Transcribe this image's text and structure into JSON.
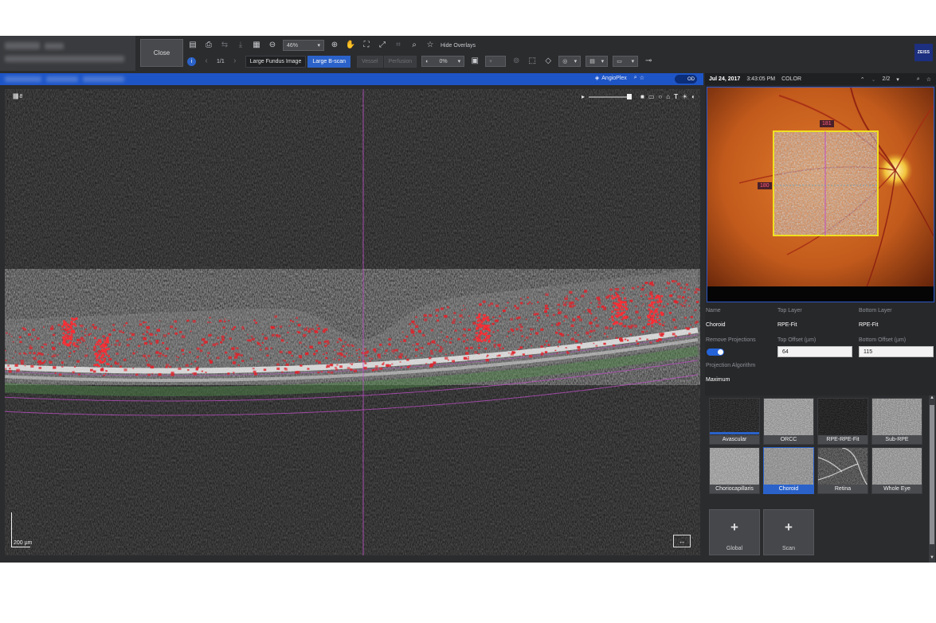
{
  "header": {
    "close_label": "Close",
    "zoom_level": "46%",
    "page_indicator": "1/1",
    "hide_overlays_label": "Hide Overlays",
    "brightness_value": "0%",
    "logo_text": "ZEISS"
  },
  "view_tabs": [
    {
      "label": "Large Fundus Image",
      "state": "normal"
    },
    {
      "label": "Large B-scan",
      "state": "active"
    },
    {
      "label": "Vessel",
      "state": "disabled"
    },
    {
      "label": "Perfusion",
      "state": "disabled"
    }
  ],
  "scan_bar": {
    "angioplex_label": "AngioPlex",
    "eye_label": "OD"
  },
  "bscan": {
    "frame_count": "8",
    "scale_label": "200 µm"
  },
  "fundus_panel": {
    "date": "Jul 24, 2017",
    "time": "3:43:05 PM",
    "mode": "COLOR",
    "page": "2/2",
    "marker_top": "181",
    "marker_left": "180"
  },
  "layer_settings": {
    "name_label": "Name",
    "name_value": "Choroid",
    "top_layer_label": "Top Layer",
    "top_layer_value": "RPE-Fit",
    "bottom_layer_label": "Bottom Layer",
    "bottom_layer_value": "RPE-Fit",
    "remove_projections_label": "Remove Projections",
    "remove_projections_on": true,
    "top_offset_label": "Top Offset (µm)",
    "top_offset_value": "64",
    "bottom_offset_label": "Bottom Offset (µm)",
    "bottom_offset_value": "115",
    "projection_algorithm_label": "Projection Algorithm",
    "projection_algorithm_value": "Maximum"
  },
  "slabs": [
    {
      "label": "Avascular",
      "selected": false
    },
    {
      "label": "ORCC",
      "selected": false
    },
    {
      "label": "RPE-RPE-Fit",
      "selected": false
    },
    {
      "label": "Sub-RPE",
      "selected": false
    },
    {
      "label": "Choriocapillaris",
      "selected": false
    },
    {
      "label": "Choroid",
      "selected": true
    },
    {
      "label": "Retina",
      "selected": false
    },
    {
      "label": "Whole Eye",
      "selected": false
    }
  ],
  "add_buttons": [
    {
      "label": "Global"
    },
    {
      "label": "Scan"
    }
  ],
  "colors": {
    "accent": "#2a62c9",
    "scan_bar": "#1e55c6",
    "flow_red": "#e0242c",
    "segmentation_magenta": "#c050c8"
  }
}
